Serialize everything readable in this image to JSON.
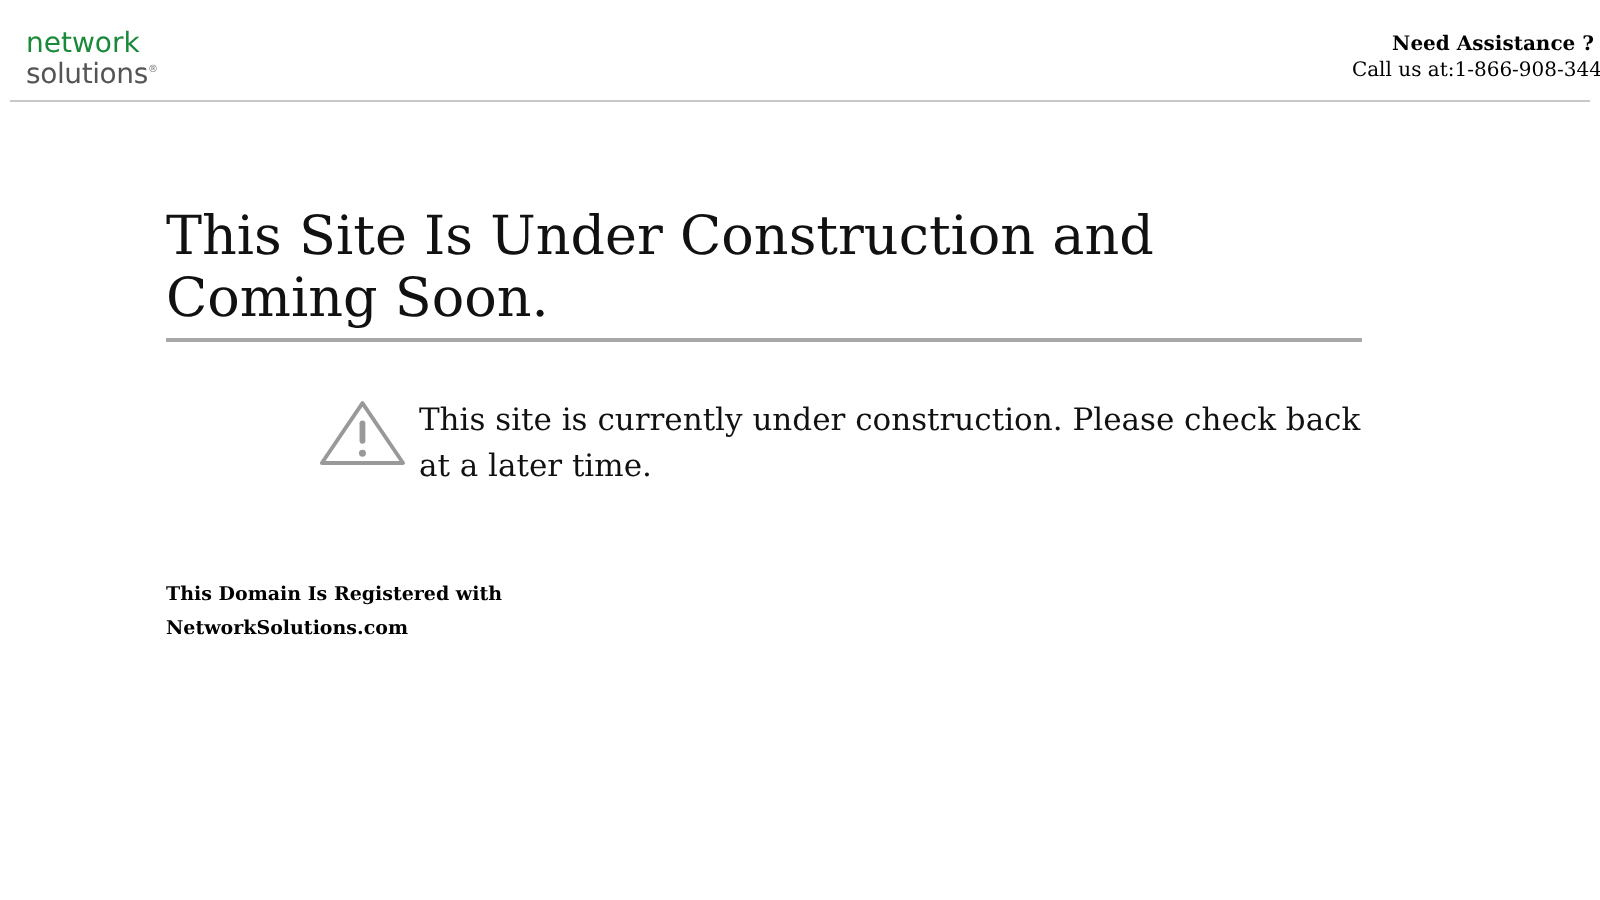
{
  "header": {
    "logo": {
      "line_1": "network",
      "line_2": "solutions",
      "mark": "®"
    },
    "assistance": {
      "title": "Need Assistance ?",
      "phone": "Call us at:1-866-908-344"
    }
  },
  "main": {
    "heading": "This Site Is Under Construction and Coming Soon.",
    "notice": "This site is currently under construction. Please check back at a later time.",
    "registration": [
      "This Domain Is Registered with",
      "NetworkSolutions.com"
    ]
  }
}
